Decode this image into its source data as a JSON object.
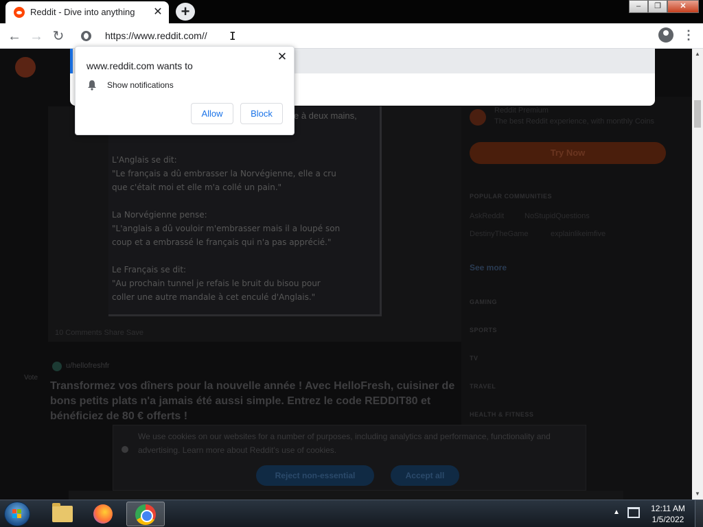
{
  "browser": {
    "tab_title": "Reddit - Dive into anything",
    "tab_close": "✕",
    "new_tab": "+",
    "url": "https://www.reddit.com//",
    "window_buttons": {
      "minimize": "‒",
      "maximize": "❐",
      "close": "✕"
    }
  },
  "permission_prompt": {
    "title": "www.reddit.com wants to",
    "permission": "Show notifications",
    "allow_label": "Allow",
    "block_label": "Block",
    "close": "✕"
  },
  "page": {
    "meme_top": "e à deux mains,",
    "meme_text": "L'Anglais se dit:\n\"Le français a dû embrasser la Norvégienne, elle a cru\nque c'était moi et elle m'a collé un pain.\"\n\nLa Norvégienne pense:\n\"L'anglais a dû vouloir m'embrasser mais il a loupé son\ncoup et a embrassé le français qui n'a pas apprécié.\"\n\nLe Français se dit:\n\"Au prochain tunnel je refais le bruit du bisou pour\ncoller une autre mandale à cet enculé d'Anglais.\"",
    "post_actions": "10 Comments      Share      Save",
    "vote_label": "Vote",
    "promoted_user": "u/hellofreshfr",
    "promo_title": "Transformez vos dîners pour la nouvelle année ! Avec HelloFresh, cuisiner de bons petits plats n'a jamais été aussi simple. Entrez le code REDDIT80 et bénéficiez de 80 € offerts !",
    "cookie_text": "We use cookies on our websites for a number of purposes, including analytics and performance, functionality and advertising. Learn more about Reddit's use of cookies.",
    "reject_label": "Reject non-essential",
    "accept_label": "Accept all"
  },
  "sidebar": {
    "premium_title": "Reddit Premium",
    "premium_text": "The best Reddit experience, with monthly Coins",
    "try_label": "Try Now",
    "popular_header": "POPULAR COMMUNITIES",
    "communities": [
      "AskReddit",
      "NoStupidQuestions",
      "DestinyTheGame",
      "explainlikeimfive"
    ],
    "see_more": "See more",
    "topics": [
      "GAMING",
      "SPORTS",
      "TV",
      "TRAVEL",
      "HEALTH & FITNESS"
    ]
  },
  "taskbar": {
    "time": "12:11 AM",
    "date": "1/5/2022",
    "tray_arrow": "▲"
  },
  "colors": {
    "chrome_blue": "#1a73e8",
    "reddit_orange": "#ff4500"
  }
}
